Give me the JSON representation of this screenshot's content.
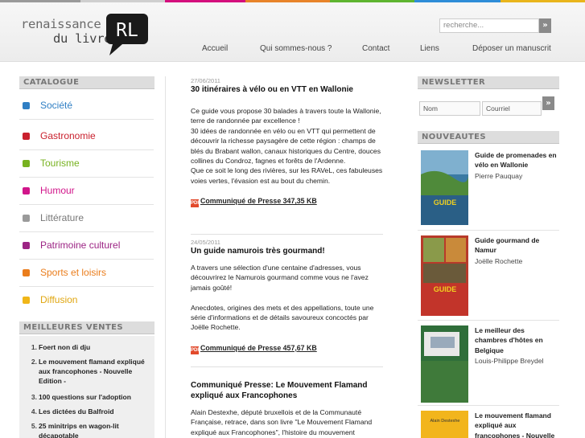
{
  "colors": {
    "bar1": "#8c8c8c",
    "bar2": "#d40f7d",
    "bar3": "#e8842a",
    "bar4": "#5fb531",
    "bar5": "#2f8dd8",
    "bar6": "#e9b51c"
  },
  "logo": {
    "line1": "renaissance",
    "line2": "du livre",
    "mark": "RL"
  },
  "search": {
    "placeholder": "recherche...",
    "button": "»"
  },
  "nav": [
    "Accueil",
    "Qui sommes-nous ?",
    "Contact",
    "Liens",
    "Déposer un manuscrit"
  ],
  "catalogue": {
    "title": "CATALOGUE",
    "items": [
      {
        "label": "Société",
        "color": "#2f7fc4"
      },
      {
        "label": "Gastronomie",
        "color": "#c9202d"
      },
      {
        "label": "Tourisme",
        "color": "#77b21f"
      },
      {
        "label": "Humour",
        "color": "#d1158a"
      },
      {
        "label": "Littérature",
        "color": "#9a9a9a"
      },
      {
        "label": "Patrimoine culturel",
        "color": "#9c2484"
      },
      {
        "label": "Sports et loisirs",
        "color": "#ea7d1c"
      },
      {
        "label": "Diffusion",
        "color": "#f0b618"
      }
    ]
  },
  "best": {
    "title": "MEILLEURES VENTES",
    "items": [
      {
        "n": "1.",
        "t": "Foert non di dju"
      },
      {
        "n": "2.",
        "t": "Le mouvement flamand expliqué aux francophones - Nouvelle Edition -"
      },
      {
        "n": "3.",
        "t": "100 questions sur l'adoption"
      },
      {
        "n": "4.",
        "t": "Les dictées du Balfroid"
      },
      {
        "n": "5.",
        "t": "25 minitrips en wagon-lit décapotable"
      }
    ]
  },
  "news": [
    {
      "date": "27/06/2011",
      "title": "30 itinéraires à vélo ou en VTT en Wallonie",
      "body": "Ce guide vous propose 30 balades à travers toute la Wallonie, terre de randonnée par excellence !\n30 idées de randonnée en vélo ou en VTT qui permettent de découvrir la richesse paysagère de cette région : champs de blés du Brabant wallon, canaux historiques du Centre, douces collines du Condroz, fagnes et forêts de l'Ardenne.\nQue ce soit le long des rivières, sur les RAVeL, ces fabuleuses voies  vertes, l'évasion est au bout du chemin.",
      "pdf": "Communiqué de Presse 347,35 KB"
    },
    {
      "date": "24/05/2011",
      "title": "Un guide namurois très gourmand!",
      "body": "A travers une sélection d'une centaine d'adresses, vous découvrirez le Namurois gourmand comme vous ne l'avez jamais goûté!\n\nAnecdotes, origines des mets et des appellations, toute une série d'informations et de détails savoureux concoctés par Joëlle Rochette.",
      "pdf": "Communiqué de Presse 457,67 KB"
    },
    {
      "date": "",
      "title": "Communiqué Presse: Le Mouvement Flamand expliqué aux Francophones",
      "body": "Alain Destexhe, député bruxellois et de la Communauté Française, retrace, dans son livre \"Le Mouvement Flamand expliqué aux Francophones\", l'histoire du mouvement",
      "pdf": ""
    }
  ],
  "newsletter": {
    "title": "NEWSLETTER",
    "name_placeholder": "Nom",
    "email_placeholder": "Courriel",
    "button": "»"
  },
  "nouveautes": {
    "title": "NOUVEAUTES",
    "books": [
      {
        "title": "Guide de promenades en vélo en Wallonie",
        "author": "Pierre Pauquay",
        "cover": "GUIDE"
      },
      {
        "title": "Guide gourmand de Namur",
        "author": "Joëlle Rochette",
        "cover": "GUIDE"
      },
      {
        "title": "Le meilleur des chambres d'hôtes en Belgique",
        "author": "Louis-Philippe Breydel",
        "cover": ""
      },
      {
        "title": "Le mouvement flamand expliqué aux francophones - Nouvelle",
        "author": "",
        "cover": "Alain Destexhe"
      }
    ]
  }
}
